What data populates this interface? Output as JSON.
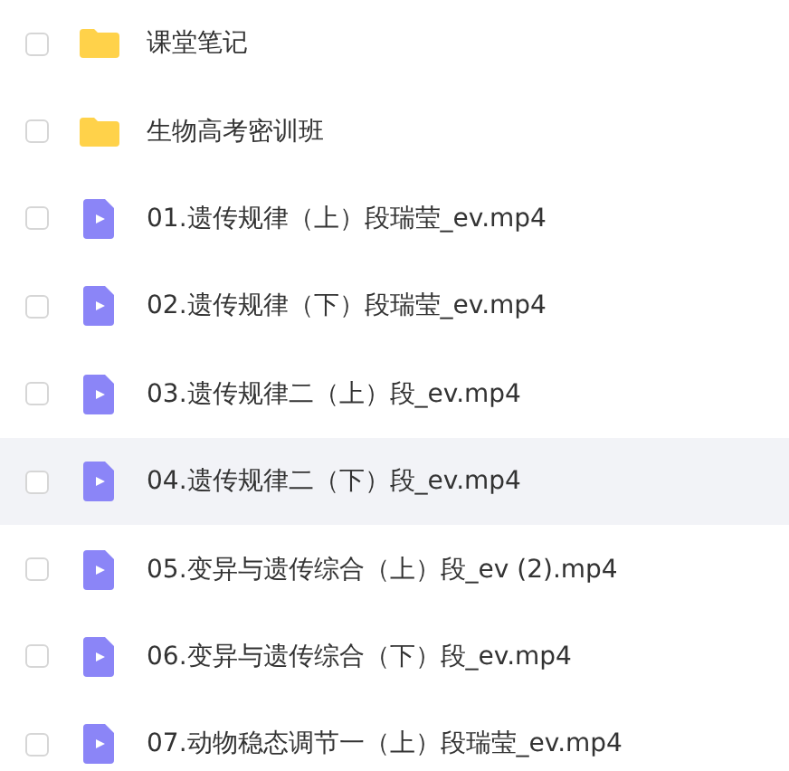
{
  "files": [
    {
      "kind": "folder",
      "name": "课堂笔记",
      "checked": false,
      "highlighted": false
    },
    {
      "kind": "folder",
      "name": "生物高考密训班",
      "checked": false,
      "highlighted": false
    },
    {
      "kind": "video",
      "name": "01.遗传规律（上）段瑞莹_ev.mp4",
      "checked": false,
      "highlighted": false
    },
    {
      "kind": "video",
      "name": "02.遗传规律（下）段瑞莹_ev.mp4",
      "checked": false,
      "highlighted": false
    },
    {
      "kind": "video",
      "name": "03.遗传规律二（上）段_ev.mp4",
      "checked": false,
      "highlighted": false
    },
    {
      "kind": "video",
      "name": "04.遗传规律二（下）段_ev.mp4",
      "checked": false,
      "highlighted": true
    },
    {
      "kind": "video",
      "name": "05.变异与遗传综合（上）段_ev (2).mp4",
      "checked": false,
      "highlighted": false
    },
    {
      "kind": "video",
      "name": "06.变异与遗传综合（下）段_ev.mp4",
      "checked": false,
      "highlighted": false
    },
    {
      "kind": "video",
      "name": "07.动物稳态调节一（上）段瑞莹_ev.mp4",
      "checked": false,
      "highlighted": false
    }
  ]
}
